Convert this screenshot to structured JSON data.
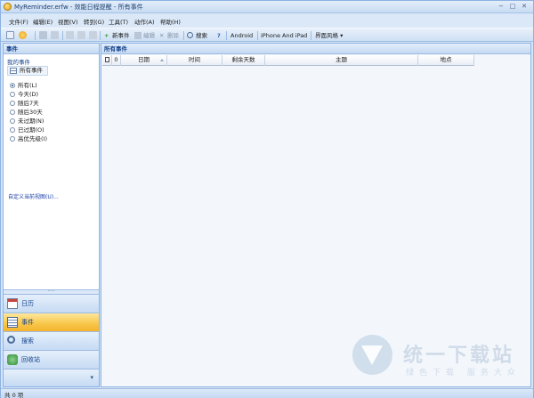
{
  "window": {
    "title": "MyReminder.erfw - 效能日程提醒 - 所有事件",
    "minimize": "−",
    "maximize": "□",
    "close": "✕"
  },
  "menu": [
    "文件(F)",
    "编辑(E)",
    "视图(V)",
    "转到(G)",
    "工具(T)",
    "动作(A)",
    "帮助(H)"
  ],
  "toolbar": {
    "new_event": "新事件",
    "edit": "编辑",
    "delete": "删除",
    "search": "搜索",
    "help": "?",
    "android": "Android",
    "ios": "iPhone And iPad",
    "theme": "界面风格 ▾"
  },
  "left_pane": {
    "header": "事件",
    "my_events": "我的事件",
    "all_events": "所有事件",
    "filters": [
      {
        "label": "所有(L)",
        "selected": true
      },
      {
        "label": "今天(D)",
        "selected": false
      },
      {
        "label": "随后7天",
        "selected": false
      },
      {
        "label": "随后30天",
        "selected": false
      },
      {
        "label": "未过期(N)",
        "selected": false
      },
      {
        "label": "已过期(O)",
        "selected": false
      },
      {
        "label": "高优先级(I)",
        "selected": false
      }
    ],
    "customize_link": "自定义当前视图(U)..."
  },
  "nav": {
    "calendar": "日历",
    "events": "事件",
    "search": "搜索",
    "recycle": "回收站"
  },
  "main": {
    "header": "所有事件",
    "columns": {
      "doc": "",
      "attach": "",
      "date": "日期",
      "time": "时间",
      "remaining": "剩余天数",
      "subject": "主题",
      "location": "地点"
    }
  },
  "status": {
    "text": "共 0 项"
  },
  "watermark": {
    "text": "统一下载站",
    "sub": "绿色下载 服务大众"
  },
  "colors": {
    "accent": "#15428b",
    "active_nav": "#f8c84d",
    "pane_border": "#8db2e3"
  }
}
